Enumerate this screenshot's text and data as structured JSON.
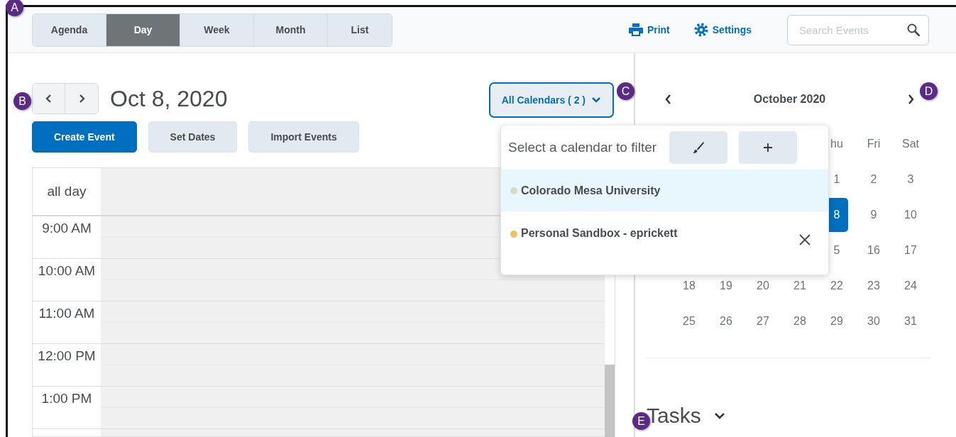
{
  "view_tabs": [
    {
      "label": "Agenda",
      "selected": false
    },
    {
      "label": "Day",
      "selected": true
    },
    {
      "label": "Week",
      "selected": false
    },
    {
      "label": "Month",
      "selected": false
    },
    {
      "label": "List",
      "selected": false
    }
  ],
  "toolbar": {
    "print": "Print",
    "settings": "Settings",
    "search": {
      "placeholder": "Search Events"
    }
  },
  "date_nav": {
    "date": "Oct 8, 2020"
  },
  "actions": [
    {
      "label": "Create Event",
      "kind": "primary"
    },
    {
      "label": "Set Dates",
      "kind": "secondary"
    },
    {
      "label": "Import Events",
      "kind": "secondary"
    }
  ],
  "calendar_filter": {
    "label": "All Calendars ( 2 )",
    "expanded": true
  },
  "filter_popup": {
    "title": "Select a calendar to filter",
    "calendars": [
      {
        "name": "Colorado Mesa University",
        "color": "#d6dcc4",
        "selected": true,
        "removable": false
      },
      {
        "name": "Personal Sandbox - eprickett",
        "color": "#eac45a",
        "selected": false,
        "removable": true
      }
    ]
  },
  "day_grid": {
    "all_day": "all day",
    "hours": [
      "9:00 AM",
      "10:00 AM",
      "11:00 AM",
      "12:00 PM",
      "1:00 PM"
    ]
  },
  "mini_calendar": {
    "month": "October 2020",
    "weekdays": [
      "hu",
      "Fri",
      "Sat"
    ],
    "weeks": [
      [
        {
          "day": "1",
          "selected": false
        },
        {
          "day": "2",
          "selected": false
        },
        {
          "day": "3",
          "selected": false
        }
      ],
      [
        {
          "day": "8",
          "selected": true
        },
        {
          "day": "9",
          "selected": false
        },
        {
          "day": "10",
          "selected": false
        }
      ],
      [
        {
          "day": "5",
          "selected": false
        },
        {
          "day": "16",
          "selected": false
        },
        {
          "day": "17",
          "selected": false
        }
      ],
      [
        {
          "day": "18",
          "selected": false
        },
        {
          "day": "19",
          "selected": false
        },
        {
          "day": "20",
          "selected": false
        },
        {
          "day": "21",
          "selected": false
        },
        {
          "day": "22",
          "selected": false
        },
        {
          "day": "23",
          "selected": false
        },
        {
          "day": "24",
          "selected": false
        }
      ],
      [
        {
          "day": "25",
          "selected": false
        },
        {
          "day": "26",
          "selected": false
        },
        {
          "day": "27",
          "selected": false
        },
        {
          "day": "28",
          "selected": false
        },
        {
          "day": "29",
          "selected": false
        },
        {
          "day": "30",
          "selected": false
        },
        {
          "day": "31",
          "selected": false
        }
      ]
    ]
  },
  "tasks": {
    "title": "Tasks"
  },
  "annotations": [
    "A",
    "B",
    "C",
    "D",
    "E"
  ]
}
